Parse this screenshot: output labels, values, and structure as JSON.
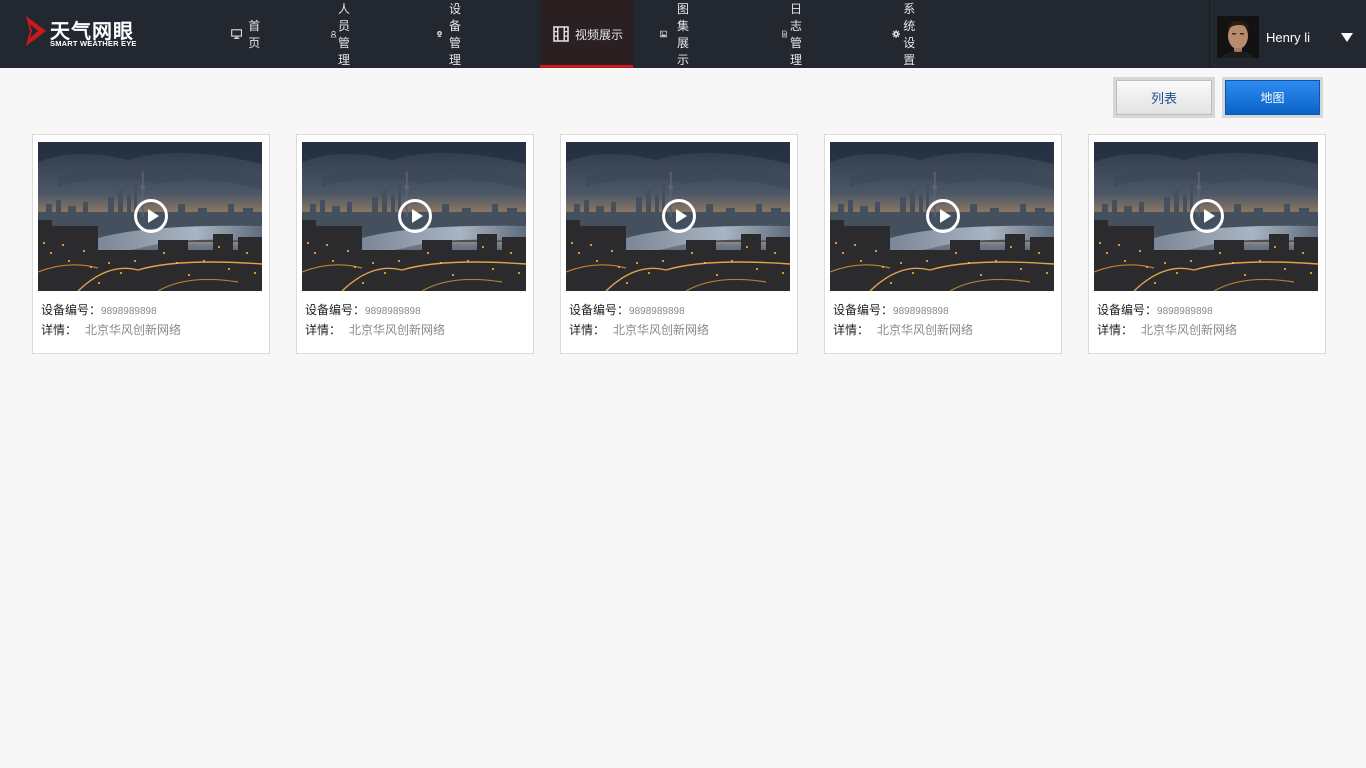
{
  "brand": {
    "name_cn": "天气网眼",
    "name_en": "SMART WEATHER EYE",
    "accent_color": "#c9191e"
  },
  "nav": {
    "items": [
      {
        "label": "首页",
        "icon": "monitor-icon",
        "active": false
      },
      {
        "label": "人员管理",
        "icon": "person-icon",
        "active": false
      },
      {
        "label": "设备管理",
        "icon": "webcam-icon",
        "active": false
      },
      {
        "label": "视频展示",
        "icon": "film-icon",
        "active": true
      },
      {
        "label": "图集展示",
        "icon": "image-icon",
        "active": false
      },
      {
        "label": "日志管理",
        "icon": "document-icon",
        "active": false
      },
      {
        "label": "系统设置",
        "icon": "gear-icon",
        "active": false
      }
    ]
  },
  "user": {
    "name": "Henry li",
    "menu_icon": "caret-down-icon"
  },
  "view_toggle": {
    "list_label": "列表",
    "map_label": "地图",
    "selected": "地图"
  },
  "cards": [
    {
      "device_label": "设备编号：",
      "device_id": "9898989898",
      "detail_label": "详情：",
      "detail": "北京华风创新网络",
      "thumbnail": "city-skyline-dusk",
      "play_icon": "play-icon"
    },
    {
      "device_label": "设备编号：",
      "device_id": "9898989898",
      "detail_label": "详情：",
      "detail": "北京华风创新网络",
      "thumbnail": "city-skyline-dusk",
      "play_icon": "play-icon"
    },
    {
      "device_label": "设备编号：",
      "device_id": "9898989898",
      "detail_label": "详情：",
      "detail": "北京华风创新网络",
      "thumbnail": "city-skyline-dusk",
      "play_icon": "play-icon"
    },
    {
      "device_label": "设备编号：",
      "device_id": "9898989898",
      "detail_label": "详情：",
      "detail": "北京华风创新网络",
      "thumbnail": "city-skyline-dusk",
      "play_icon": "play-icon"
    },
    {
      "device_label": "设备编号：",
      "device_id": "9898989898",
      "detail_label": "详情：",
      "detail": "北京华风创新网络",
      "thumbnail": "city-skyline-dusk",
      "play_icon": "play-icon"
    }
  ]
}
